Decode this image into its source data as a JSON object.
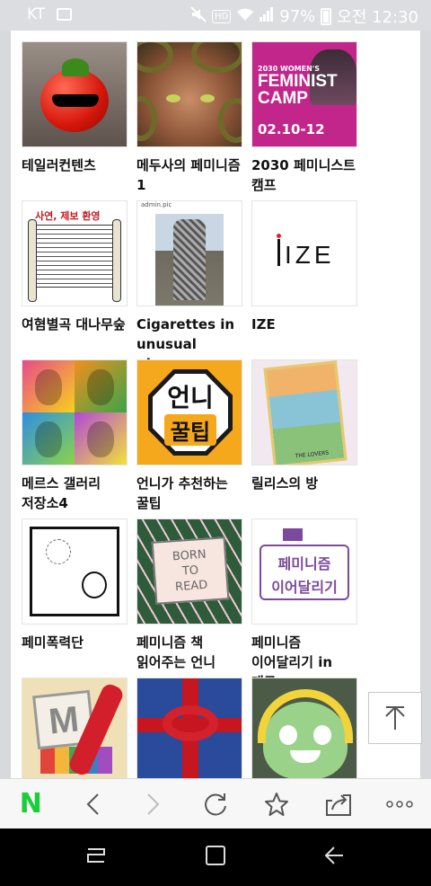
{
  "status_bar": {
    "carrier": "KT",
    "battery": "97%",
    "time": "오전 12:30",
    "hd_badge": "HD",
    "icons": [
      "gallery-icon",
      "mute-icon",
      "hd-voice-icon",
      "wifi-icon",
      "signal-icon",
      "battery-icon"
    ]
  },
  "grid": {
    "items": [
      {
        "label": "테일러컨텐츠",
        "thumb": "tomato"
      },
      {
        "label": "메두사의 페미니즘 1",
        "thumb": "medusa"
      },
      {
        "label": "2030 페미니스트 캠프",
        "thumb": "camp",
        "thumb_text": {
          "line1": "2030 WOMEN'S",
          "line2": "FEMINIST",
          "line3": "CAMP",
          "date": "02.10-12"
        }
      },
      {
        "label": "여혐별곡 대나무숲",
        "thumb": "scroll",
        "thumb_text": "사연, 제보 환영"
      },
      {
        "label": "Cigarettes in unusual places",
        "thumb": "cigarettes",
        "thumb_text": "admin.pic"
      },
      {
        "label": "IZE",
        "thumb": "ize",
        "thumb_text": "IZE"
      },
      {
        "label": "메르스 갤러리 저장소4",
        "thumb": "popart"
      },
      {
        "label": "언니가 추천하는 꿀팁",
        "thumb": "unni",
        "thumb_text": {
          "line1": "언니",
          "line2": "꿀팁"
        }
      },
      {
        "label": "릴리스의 방",
        "thumb": "tarot",
        "thumb_text": "THE LOVERS"
      },
      {
        "label": "페미폭력단",
        "thumb": "comic"
      },
      {
        "label": "페미니즘 책 읽어주는 언니",
        "thumb": "born",
        "thumb_text": {
          "line1": "BORN",
          "line2": "TO",
          "line3": "READ"
        }
      },
      {
        "label": "페미니즘 이어달리기 in 대구",
        "thumb": "relay",
        "thumb_text": {
          "line1": "페미니즘",
          "line2": "이어달리기"
        }
      },
      {
        "label": "",
        "thumb": "m",
        "thumb_text": "M"
      },
      {
        "label": "",
        "thumb": "gift"
      },
      {
        "label": "",
        "thumb": "frog"
      }
    ]
  },
  "toolbar": {
    "home": "N",
    "buttons": [
      "naver-home-button",
      "back-button",
      "forward-button",
      "refresh-button",
      "bookmark-button",
      "share-button",
      "more-button"
    ]
  },
  "colors": {
    "naver_green": "#19ce3a",
    "status_bg": "#dcdde0"
  }
}
